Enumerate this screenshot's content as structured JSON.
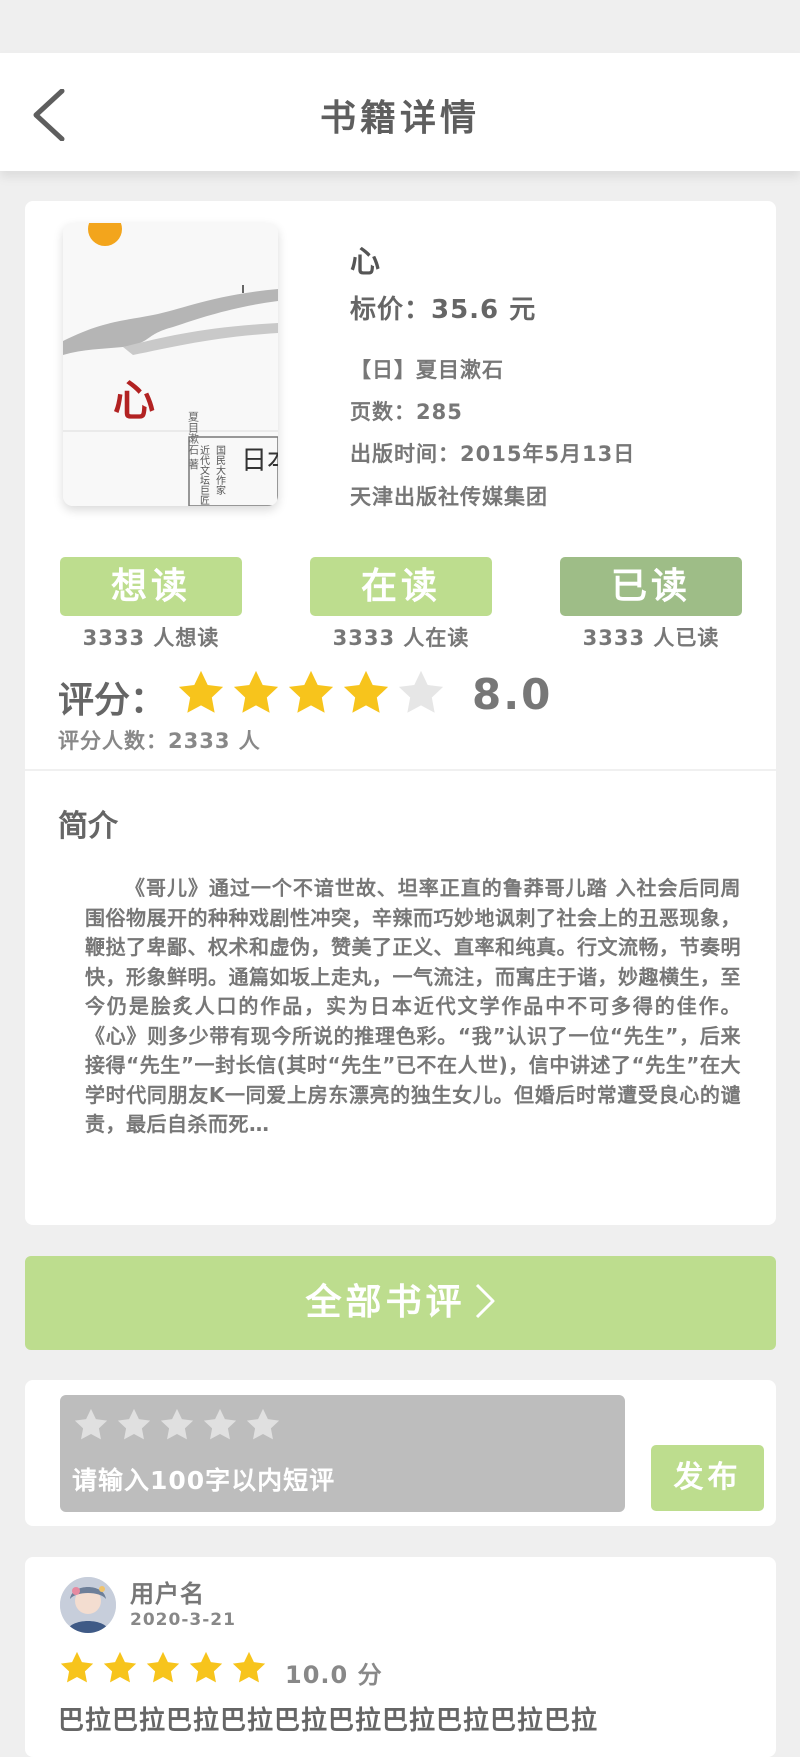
{
  "header": {
    "title": "书籍详情"
  },
  "book": {
    "title": "心",
    "price": "标价：35.6 元",
    "author": "【日】夏目漱石",
    "pages": "页数：285",
    "publish_date": "出版时间：2015年5月13日",
    "publisher": "天津出版社传媒集团",
    "cover": {
      "title_char": "心",
      "side_text": "日本",
      "author_text": "夏目漱石 著",
      "series_text_1": "近代文坛巨匠",
      "series_text_2": "国民大作家"
    }
  },
  "status_buttons": [
    {
      "label": "想读",
      "count": "3333 人想读",
      "color": "#bddd8e"
    },
    {
      "label": "在读",
      "count": "3333 人在读",
      "color": "#bddd8e"
    },
    {
      "label": "已读",
      "count": "3333 人已读",
      "color": "#9ebd87"
    }
  ],
  "rating": {
    "label": "评分：",
    "stars_filled": 4,
    "stars_total": 5,
    "score": "8.0",
    "count": "评分人数：2333 人",
    "star_color": "#f7c41c",
    "empty_star_color": "#e6e6e6"
  },
  "intro": {
    "heading": "简介",
    "text": "《哥儿》通过一个不谙世故、坦率正直的鲁莽哥儿踏 入社会后同周围俗物展开的种种戏剧性冲突，辛辣而巧妙地讽刺了社会上的丑恶现象，鞭挞了卑鄙、权术和虚伪，赞美了正义、直率和纯真。行文流畅，节奏明快，形象鲜明。通篇如坂上走丸，一气流注，而寓庄于谐，妙趣横生，至今仍是脍炙人口的作品，实为日本近代文学作品中不可多得的佳作。《心》则多少带有现今所说的推理色彩。“我”认识了一位“先生”，后来接得“先生”一封长信(其时“先生”已不在人世)，信中讲述了“先生”在大学时代同朋友K一同爱上房东漂亮的独生女儿。但婚后时常遭受良心的谴责，最后自杀而死…"
  },
  "all_reviews": {
    "label": "全部书评"
  },
  "compose": {
    "placeholder": "请输入100字以内短评",
    "publish_label": "发布"
  },
  "review": {
    "username": "用户名",
    "date": "2020-3-21",
    "stars_filled": 5,
    "score": "10.0 分",
    "text": "巴拉巴拉巴拉巴拉巴拉巴拉巴拉巴拉巴拉巴拉"
  }
}
